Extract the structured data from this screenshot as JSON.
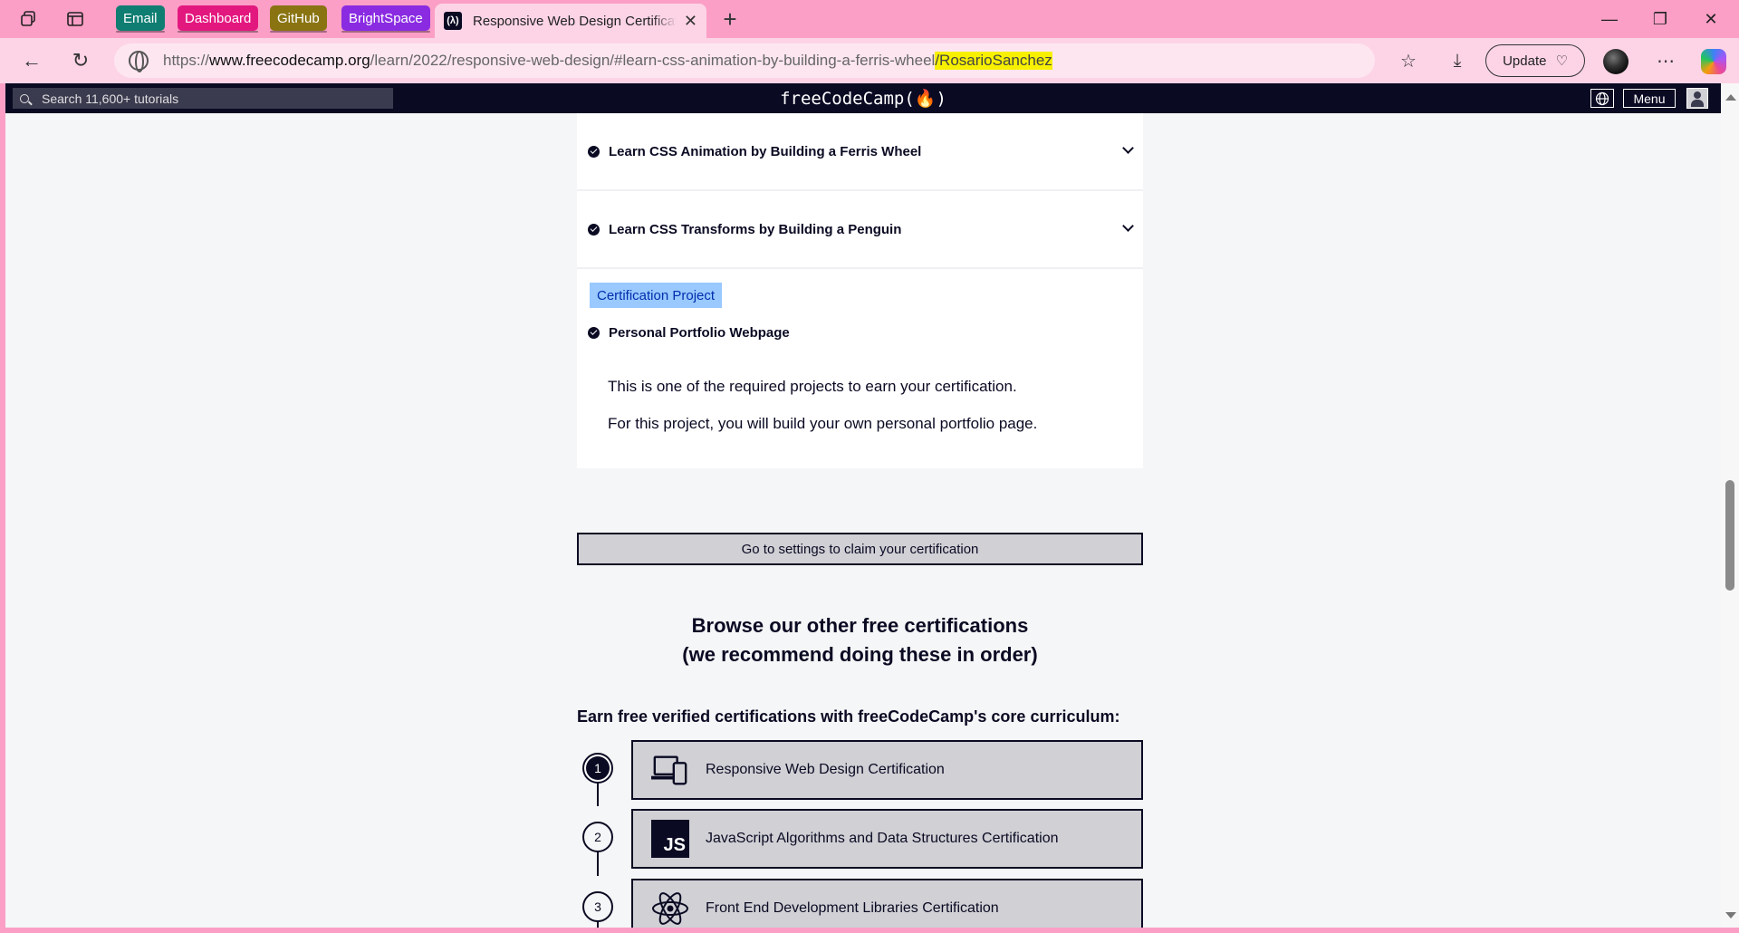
{
  "browser": {
    "bookmarks": [
      {
        "label": "Email",
        "color": "#0f7d72"
      },
      {
        "label": "Dashboard",
        "color": "#e3187f"
      },
      {
        "label": "GitHub",
        "color": "#8a7412"
      },
      {
        "label": "BrightSpace",
        "color": "#8a2be2"
      }
    ],
    "active_tab_title": "Responsive Web Design Certification",
    "favicon_text": "(λ)",
    "url_prefix": "https://",
    "url_host": "www.freecodecamp.org",
    "url_path": "/learn/2022/responsive-web-design/#learn-css-animation-by-building-a-ferris-wheel",
    "url_highlight": "/RosarioSanchez",
    "update_label": "Update"
  },
  "fcc_nav": {
    "search_placeholder": "Search 11,600+ tutorials",
    "logo": "freeCodeCamp(🔥)",
    "menu_label": "Menu"
  },
  "blocks": [
    {
      "title": "Learn CSS Animation by Building a Ferris Wheel"
    },
    {
      "title": "Learn CSS Transforms by Building a Penguin"
    }
  ],
  "project": {
    "tag": "Certification Project",
    "title": "Personal Portfolio Webpage",
    "desc1": "This is one of the required projects to earn your certification.",
    "desc2": "For this project, you will build your own personal portfolio page."
  },
  "claim_button": "Go to settings to claim your certification",
  "browse_heading_1": "Browse our other free certifications",
  "browse_heading_2": "(we recommend doing these in order)",
  "earn_heading": "Earn free verified certifications with freeCodeCamp's core curriculum:",
  "certifications": [
    {
      "step": "1",
      "label": "Responsive Web Design Certification",
      "icon": "devices-icon",
      "completed": true
    },
    {
      "step": "2",
      "label": "JavaScript Algorithms and Data Structures Certification",
      "icon": "js-icon",
      "icon_text": "JS",
      "completed": false
    },
    {
      "step": "3",
      "label": "Front End Development Libraries Certification",
      "icon": "react-icon",
      "completed": false
    }
  ]
}
